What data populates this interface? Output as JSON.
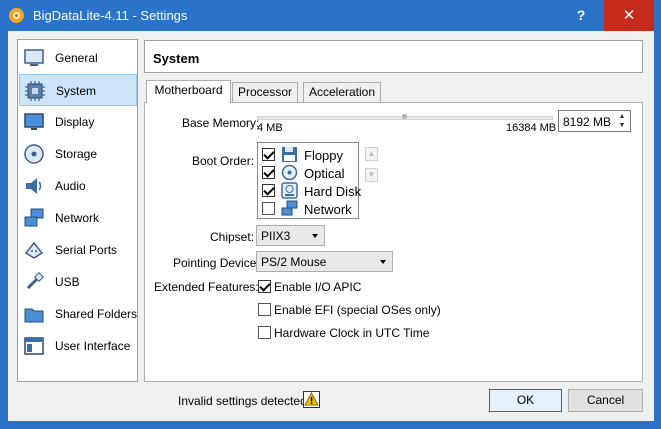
{
  "window": {
    "title": "BigDataLite-4.11 - Settings",
    "help_glyph": "?",
    "close_glyph": "✕"
  },
  "sidebar": {
    "items": [
      {
        "label": "General",
        "icon": "general-icon"
      },
      {
        "label": "System",
        "icon": "system-icon",
        "selected": true
      },
      {
        "label": "Display",
        "icon": "display-icon"
      },
      {
        "label": "Storage",
        "icon": "storage-icon"
      },
      {
        "label": "Audio",
        "icon": "audio-icon"
      },
      {
        "label": "Network",
        "icon": "network-icon"
      },
      {
        "label": "Serial Ports",
        "icon": "serial-ports-icon"
      },
      {
        "label": "USB",
        "icon": "usb-icon"
      },
      {
        "label": "Shared Folders",
        "icon": "shared-folders-icon"
      },
      {
        "label": "User Interface",
        "icon": "user-interface-icon"
      }
    ]
  },
  "header": {
    "title": "System"
  },
  "tabs": [
    {
      "label": "Motherboard",
      "active": true
    },
    {
      "label": "Processor",
      "active": false
    },
    {
      "label": "Acceleration",
      "active": false
    }
  ],
  "motherboard": {
    "base_memory": {
      "label": "Base Memory:",
      "min_label": "4 MB",
      "max_label": "16384 MB",
      "value": "8192 MB"
    },
    "boot_order": {
      "label": "Boot Order:",
      "items": [
        {
          "label": "Floppy",
          "checked": true,
          "icon": "floppy-icon"
        },
        {
          "label": "Optical",
          "checked": true,
          "icon": "optical-icon"
        },
        {
          "label": "Hard Disk",
          "checked": true,
          "icon": "hard-disk-icon"
        },
        {
          "label": "Network",
          "checked": false,
          "icon": "network-icon"
        }
      ],
      "move_up_glyph": "▲",
      "move_down_glyph": "▼"
    },
    "chipset": {
      "label": "Chipset:",
      "value": "PIIX3"
    },
    "pointing_device": {
      "label": "Pointing Device:",
      "value": "PS/2 Mouse"
    },
    "extended_features": {
      "label": "Extended Features:",
      "options": [
        {
          "label": "Enable I/O APIC",
          "checked": true
        },
        {
          "label": "Enable EFI (special OSes only)",
          "checked": false
        },
        {
          "label": "Hardware Clock in UTC Time",
          "checked": false
        }
      ]
    }
  },
  "status": {
    "text": "Invalid settings detected",
    "icon": "warning-icon"
  },
  "buttons": {
    "ok": "OK",
    "cancel": "Cancel"
  },
  "colors": {
    "titlebar": "#2b73c8",
    "close": "#c42b1c",
    "selection": "#cce4f7",
    "accent": "#0078d7"
  }
}
